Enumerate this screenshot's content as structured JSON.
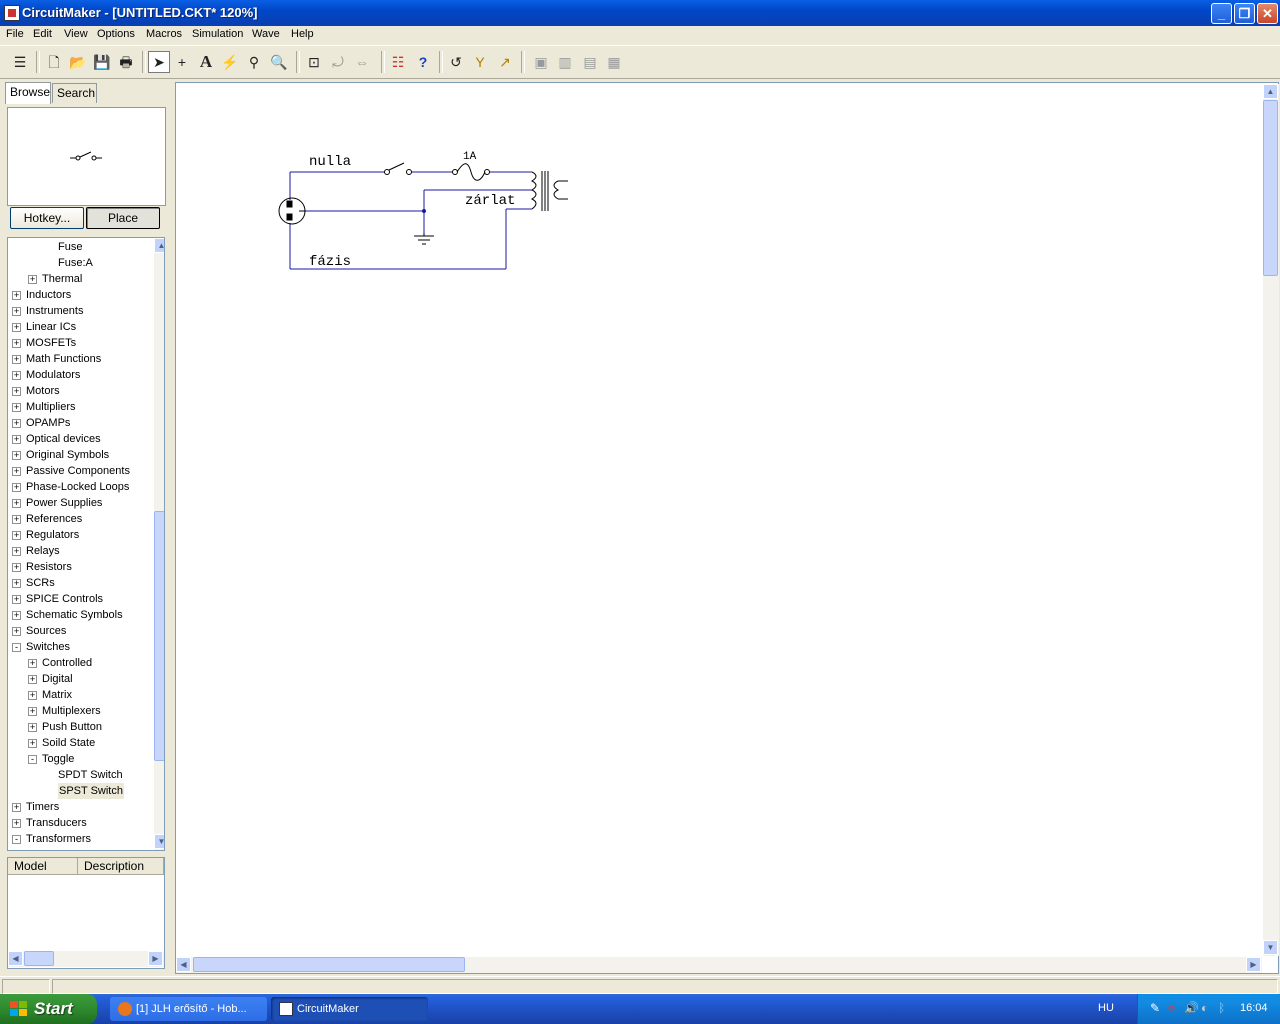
{
  "window": {
    "title": "CircuitMaker - [UNTITLED.CKT* 120%]"
  },
  "menu": [
    "File",
    "Edit",
    "View",
    "Options",
    "Macros",
    "Simulation",
    "Wave",
    "Help"
  ],
  "tabs": {
    "browse": "Browse",
    "search": "Search"
  },
  "buttons": {
    "hotkey": "Hotkey...",
    "place": "Place"
  },
  "tree": [
    {
      "label": "Fuse",
      "level": 2,
      "exp": ""
    },
    {
      "label": "Fuse:A",
      "level": 2,
      "exp": ""
    },
    {
      "label": "Thermal",
      "level": 1,
      "exp": "+"
    },
    {
      "label": "Inductors",
      "level": 0,
      "exp": "+"
    },
    {
      "label": "Instruments",
      "level": 0,
      "exp": "+"
    },
    {
      "label": "Linear ICs",
      "level": 0,
      "exp": "+"
    },
    {
      "label": "MOSFETs",
      "level": 0,
      "exp": "+"
    },
    {
      "label": "Math Functions",
      "level": 0,
      "exp": "+"
    },
    {
      "label": "Modulators",
      "level": 0,
      "exp": "+"
    },
    {
      "label": "Motors",
      "level": 0,
      "exp": "+"
    },
    {
      "label": "Multipliers",
      "level": 0,
      "exp": "+"
    },
    {
      "label": "OPAMPs",
      "level": 0,
      "exp": "+"
    },
    {
      "label": "Optical devices",
      "level": 0,
      "exp": "+"
    },
    {
      "label": "Original Symbols",
      "level": 0,
      "exp": "+"
    },
    {
      "label": "Passive Components",
      "level": 0,
      "exp": "+"
    },
    {
      "label": "Phase-Locked Loops",
      "level": 0,
      "exp": "+"
    },
    {
      "label": "Power Supplies",
      "level": 0,
      "exp": "+"
    },
    {
      "label": "References",
      "level": 0,
      "exp": "+"
    },
    {
      "label": "Regulators",
      "level": 0,
      "exp": "+"
    },
    {
      "label": "Relays",
      "level": 0,
      "exp": "+"
    },
    {
      "label": "Resistors",
      "level": 0,
      "exp": "+"
    },
    {
      "label": "SCRs",
      "level": 0,
      "exp": "+"
    },
    {
      "label": "SPICE Controls",
      "level": 0,
      "exp": "+"
    },
    {
      "label": "Schematic Symbols",
      "level": 0,
      "exp": "+"
    },
    {
      "label": "Sources",
      "level": 0,
      "exp": "+"
    },
    {
      "label": "Switches",
      "level": 0,
      "exp": "-"
    },
    {
      "label": "Controlled",
      "level": 1,
      "exp": "+"
    },
    {
      "label": "Digital",
      "level": 1,
      "exp": "+"
    },
    {
      "label": "Matrix",
      "level": 1,
      "exp": "+"
    },
    {
      "label": "Multiplexers",
      "level": 1,
      "exp": "+"
    },
    {
      "label": "Push Button",
      "level": 1,
      "exp": "+"
    },
    {
      "label": "Soild State",
      "level": 1,
      "exp": "+"
    },
    {
      "label": "Toggle",
      "level": 1,
      "exp": "-"
    },
    {
      "label": "SPDT Switch",
      "level": 2,
      "exp": ""
    },
    {
      "label": "SPST Switch",
      "level": 2,
      "exp": "",
      "selected": true
    },
    {
      "label": "Timers",
      "level": 0,
      "exp": "+"
    },
    {
      "label": "Transducers",
      "level": 0,
      "exp": "+"
    },
    {
      "label": "Transformers",
      "level": 0,
      "exp": "-"
    }
  ],
  "model_table": {
    "col1": "Model",
    "col2": "Description"
  },
  "schematic": {
    "label_nulla": "nulla",
    "label_fuse": "1A",
    "label_zarlat": "zárlat",
    "label_fazis": "fázis"
  },
  "taskbar": {
    "start": "Start",
    "task1": "[1] JLH erősítő - Hob...",
    "task2": "CircuitMaker",
    "lang": "HU",
    "clock": "16:04"
  }
}
